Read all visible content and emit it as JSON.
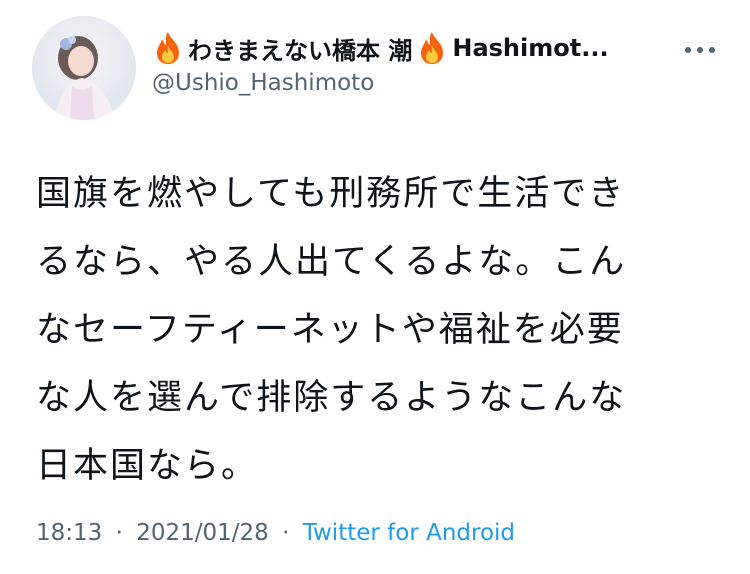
{
  "author": {
    "name_part1": "わきまえない橋本 潮",
    "name_part2": "Hashimot...",
    "handle": "@Ushio_Hashimoto",
    "avatar_icon": "profile-photo",
    "name_icon": "fire-icon"
  },
  "more_icon": "more-horizontal-icon",
  "tweet": {
    "text": "国旗を燃やしても刑務所で生活でき\nるなら、やる人出てくるよな。こん\nなセーフティーネットや福祉を必要\nな人を選んで排除するようなこんな\n日本国なら。"
  },
  "meta": {
    "time": "18:13",
    "separator": "·",
    "date": "2021/01/28",
    "source": "Twitter for Android"
  },
  "colors": {
    "text": "#0f1419",
    "secondary": "#536471",
    "link": "#1d9bf0"
  }
}
